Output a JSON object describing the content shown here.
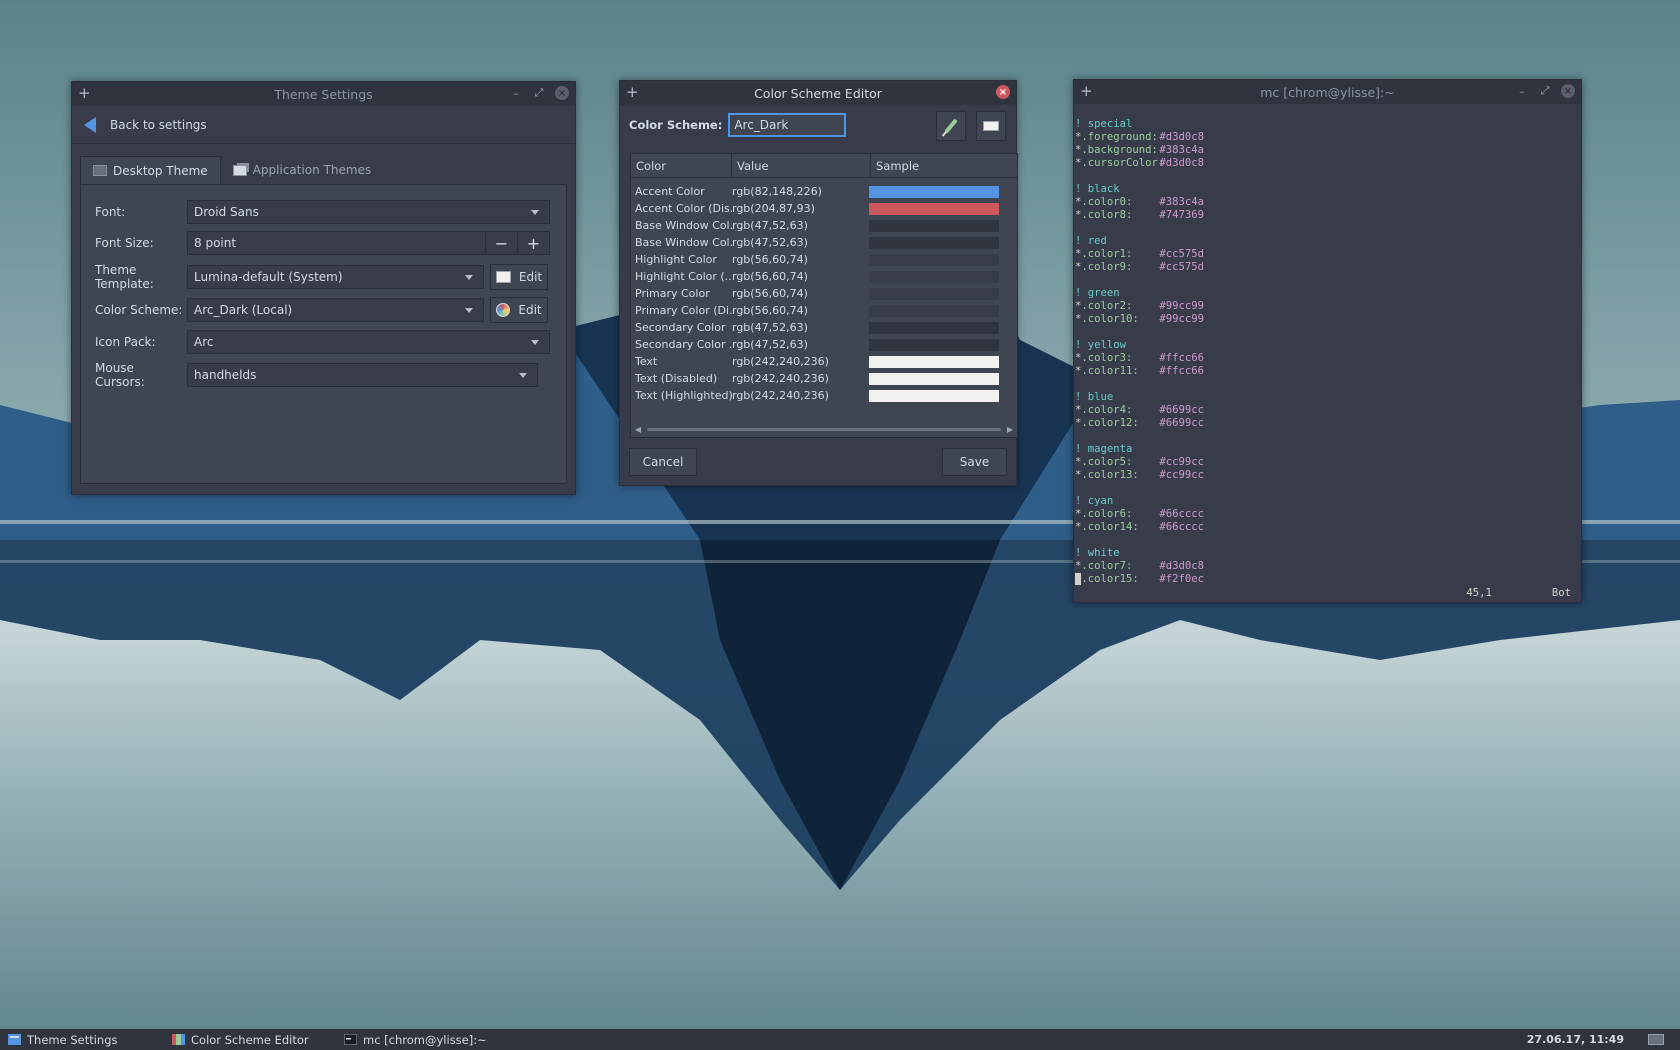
{
  "theme_settings": {
    "title": "Theme Settings",
    "back_label": "Back to settings",
    "tabs": [
      "Desktop Theme",
      "Application Themes"
    ],
    "rows": {
      "font_label": "Font:",
      "font_value": "Droid Sans",
      "size_label": "Font Size:",
      "size_value": "8 point",
      "template_label": "Theme Template:",
      "template_value": "Lumina-default (System)",
      "scheme_label": "Color Scheme:",
      "scheme_value": "Arc_Dark (Local)",
      "icon_label": "Icon Pack:",
      "icon_value": "Arc",
      "cursor_label": "Mouse Cursors:",
      "cursor_value": "handhelds"
    },
    "edit_label": "Edit",
    "minus": "−",
    "plus": "+"
  },
  "color_editor": {
    "title": "Color Scheme Editor",
    "scheme_label": "Color Scheme:",
    "scheme_value": "Arc_Dark",
    "columns": [
      "Color",
      "Value",
      "Sample"
    ],
    "rows": [
      {
        "name": "Accent Color",
        "value": "rgb(82,148,226)",
        "color": "#5294e2"
      },
      {
        "name": "Accent Color (Dis...",
        "value": "rgb(204,87,93)",
        "color": "#cc575d"
      },
      {
        "name": "Base Window Col...",
        "value": "rgb(47,52,63)",
        "color": "#2f343f"
      },
      {
        "name": "Base Window Col...",
        "value": "rgb(47,52,63)",
        "color": "#2f343f"
      },
      {
        "name": "Highlight Color",
        "value": "rgb(56,60,74)",
        "color": "#383c4a"
      },
      {
        "name": "Highlight Color (...",
        "value": "rgb(56,60,74)",
        "color": "#383c4a"
      },
      {
        "name": "Primary Color",
        "value": "rgb(56,60,74)",
        "color": "#383c4a"
      },
      {
        "name": "Primary Color (Di...",
        "value": "rgb(56,60,74)",
        "color": "#383c4a"
      },
      {
        "name": "Secondary Color",
        "value": "rgb(47,52,63)",
        "color": "#2f343f"
      },
      {
        "name": "Secondary Color ...",
        "value": "rgb(47,52,63)",
        "color": "#2f343f"
      },
      {
        "name": "Text",
        "value": "rgb(242,240,236)",
        "color": "#f2f0ec"
      },
      {
        "name": "Text (Disabled)",
        "value": "rgb(242,240,236)",
        "color": "#f2f0ec"
      },
      {
        "name": "Text (Highlighted)",
        "value": "rgb(242,240,236)",
        "color": "#f2f0ec"
      }
    ],
    "cancel_label": "Cancel",
    "save_label": "Save"
  },
  "terminal": {
    "title": "mc [chrom@ylisse]:~",
    "lines": [
      {
        "type": "comment",
        "text": "! special"
      },
      {
        "type": "entry",
        "key": ".foreground:",
        "val": "#d3d0c8"
      },
      {
        "type": "entry",
        "key": ".background:",
        "val": "#383c4a"
      },
      {
        "type": "entry",
        "key": ".cursorColor:",
        "val": "#d3d0c8"
      },
      {
        "type": "blank"
      },
      {
        "type": "comment",
        "text": "! black"
      },
      {
        "type": "entry",
        "key": ".color0:",
        "val": "#383c4a"
      },
      {
        "type": "entry",
        "key": ".color8:",
        "val": "#747369"
      },
      {
        "type": "blank"
      },
      {
        "type": "comment",
        "text": "! red"
      },
      {
        "type": "entry",
        "key": ".color1:",
        "val": "#cc575d"
      },
      {
        "type": "entry",
        "key": ".color9:",
        "val": "#cc575d"
      },
      {
        "type": "blank"
      },
      {
        "type": "comment",
        "text": "! green"
      },
      {
        "type": "entry",
        "key": ".color2:",
        "val": "#99cc99"
      },
      {
        "type": "entry",
        "key": ".color10:",
        "val": "#99cc99"
      },
      {
        "type": "blank"
      },
      {
        "type": "comment",
        "text": "! yellow"
      },
      {
        "type": "entry",
        "key": ".color3:",
        "val": "#ffcc66"
      },
      {
        "type": "entry",
        "key": ".color11:",
        "val": "#ffcc66"
      },
      {
        "type": "blank"
      },
      {
        "type": "comment",
        "text": "! blue"
      },
      {
        "type": "entry",
        "key": ".color4:",
        "val": "#6699cc"
      },
      {
        "type": "entry",
        "key": ".color12:",
        "val": "#6699cc"
      },
      {
        "type": "blank"
      },
      {
        "type": "comment",
        "text": "! magenta"
      },
      {
        "type": "entry",
        "key": ".color5:",
        "val": "#cc99cc"
      },
      {
        "type": "entry",
        "key": ".color13:",
        "val": "#cc99cc"
      },
      {
        "type": "blank"
      },
      {
        "type": "comment",
        "text": "! cyan"
      },
      {
        "type": "entry",
        "key": ".color6:",
        "val": "#66cccc"
      },
      {
        "type": "entry",
        "key": ".color14:",
        "val": "#66cccc"
      },
      {
        "type": "blank"
      },
      {
        "type": "comment",
        "text": "! white"
      },
      {
        "type": "entry",
        "key": ".color7:",
        "val": "#d3d0c8"
      },
      {
        "type": "entry",
        "key": ".color15:",
        "val": "#f2f0ec",
        "cursor": true
      }
    ],
    "status_pos": "45,1",
    "status_scroll": "Bot"
  },
  "taskbar": {
    "tasks": [
      "Theme Settings",
      "Color Scheme Editor",
      "mc [chrom@ylisse]:~"
    ],
    "clock": "27.06.17, 11:49"
  },
  "colors": {
    "accent": "#5294e2",
    "close_red": "#cc575d",
    "window_bg": "#383c4a",
    "titlebar_bg": "#2f343f"
  }
}
